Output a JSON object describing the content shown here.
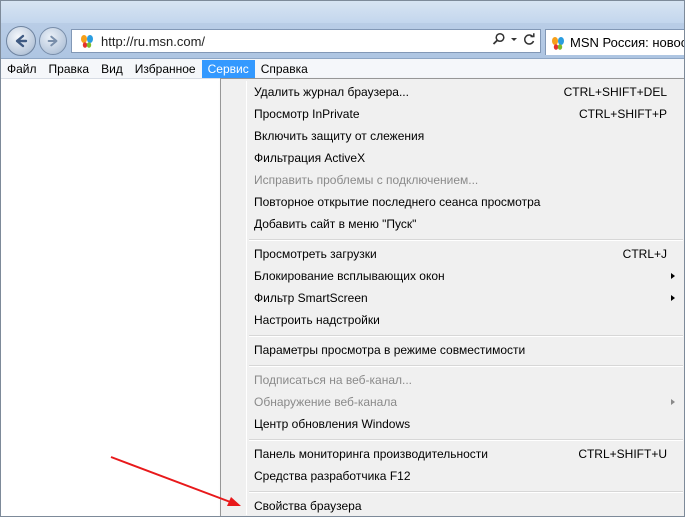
{
  "browser": {
    "url": "http://ru.msn.com/",
    "tab_title": "MSN Россия: новости",
    "back_icon": "back-arrow-icon",
    "forward_icon": "forward-arrow-icon",
    "search_icon": "search-icon",
    "dropdown_icon": "chevron-down-icon",
    "refresh_icon": "refresh-icon",
    "favicon": "msn-butterfly-icon"
  },
  "menubar": {
    "items": [
      {
        "label": "Файл"
      },
      {
        "label": "Правка"
      },
      {
        "label": "Вид"
      },
      {
        "label": "Избранное"
      },
      {
        "label": "Сервис"
      },
      {
        "label": "Справка"
      }
    ],
    "active": "Сервис"
  },
  "service_menu": {
    "items": [
      {
        "label": "Удалить журнал браузера...",
        "shortcut": "CTRL+SHIFT+DEL"
      },
      {
        "label": "Просмотр InPrivate",
        "shortcut": "CTRL+SHIFT+P"
      },
      {
        "label": "Включить защиту от слежения",
        "shortcut": ""
      },
      {
        "label": "Фильтрация ActiveX",
        "shortcut": ""
      },
      {
        "label": "Исправить проблемы с подключением...",
        "shortcut": "",
        "disabled": true
      },
      {
        "label": "Повторное открытие последнего сеанса просмотра",
        "shortcut": ""
      },
      {
        "label": "Добавить сайт в меню \"Пуск\"",
        "shortcut": ""
      },
      {
        "label": "Просмотреть загрузки",
        "shortcut": "CTRL+J"
      },
      {
        "label": "Блокирование всплывающих окон",
        "shortcut": "",
        "submenu": true
      },
      {
        "label": "Фильтр SmartScreen",
        "shortcut": "",
        "submenu": true
      },
      {
        "label": "Настроить надстройки",
        "shortcut": ""
      },
      {
        "label": "Параметры просмотра в режиме совместимости",
        "shortcut": ""
      },
      {
        "label": "Подписаться на веб-канал...",
        "shortcut": "",
        "disabled": true
      },
      {
        "label": "Обнаружение веб-канала",
        "shortcut": "",
        "disabled": true,
        "submenu": true
      },
      {
        "label": "Центр обновления Windows",
        "shortcut": ""
      },
      {
        "label": "Панель мониторинга производительности",
        "shortcut": "CTRL+SHIFT+U"
      },
      {
        "label": "Средства разработчика F12",
        "shortcut": ""
      },
      {
        "label": "Свойства браузера",
        "shortcut": ""
      }
    ]
  },
  "colors": {
    "menu_active_bg": "#3399ff",
    "annotation_arrow": "#e8191b"
  }
}
